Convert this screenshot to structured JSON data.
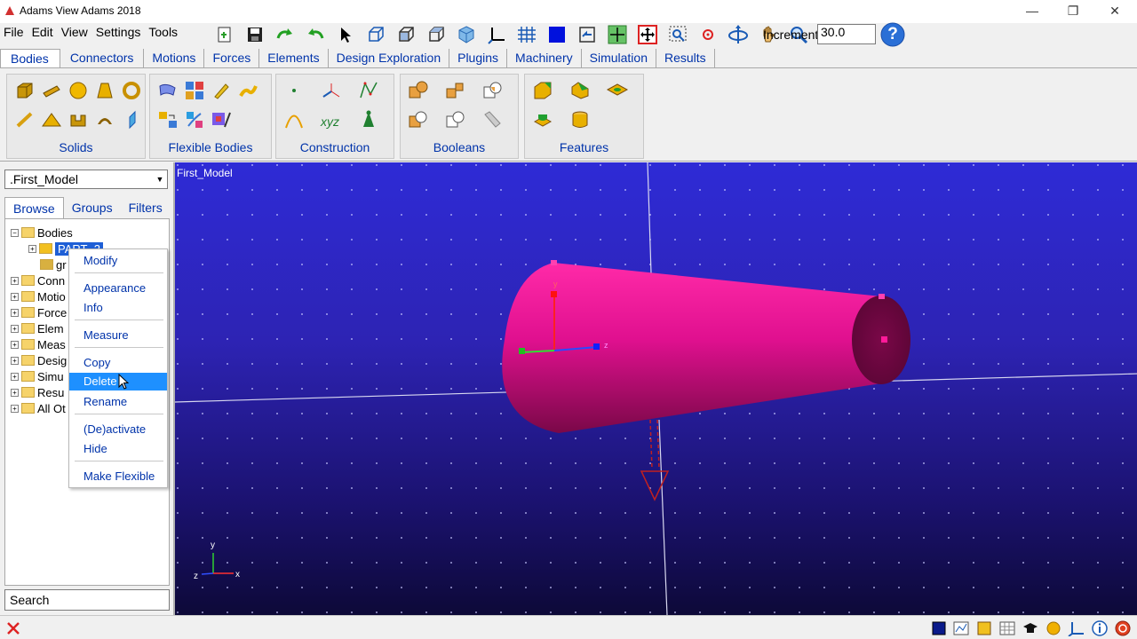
{
  "window": {
    "title": "Adams View Adams 2018",
    "minimize": "—",
    "maximize": "❐",
    "close": "✕"
  },
  "menu": [
    "File",
    "Edit",
    "View",
    "Settings",
    "Tools"
  ],
  "toolbar": {
    "increment_label": "Increment",
    "increment_value": "30.0",
    "help_glyph": "?"
  },
  "ribbon_tabs": [
    "Bodies",
    "Connectors",
    "Motions",
    "Forces",
    "Elements",
    "Design Exploration",
    "Plugins",
    "Machinery",
    "Simulation",
    "Results"
  ],
  "ribbon_groups": {
    "solids": "Solids",
    "flexible": "Flexible Bodies",
    "construction": "Construction",
    "booleans": "Booleans",
    "features": "Features"
  },
  "construction_xyz": "xyz",
  "browser": {
    "model": ".First_Model",
    "tabs": [
      "Browse",
      "Groups",
      "Filters"
    ],
    "tree": {
      "bodies": "Bodies",
      "part": "PART_2",
      "ground": "gr",
      "items": [
        "Conn",
        "Motio",
        "Force",
        "Elem",
        "Meas",
        "Desig",
        "Simu",
        "Resu",
        "All Ot"
      ]
    },
    "search": "Search"
  },
  "viewport": {
    "label": "First_Model",
    "triad": {
      "x": "x",
      "y": "y",
      "z": "z"
    },
    "marker_z": "z",
    "marker_y": "y"
  },
  "context_menu": {
    "modify": "Modify",
    "appearance": "Appearance",
    "info": "Info",
    "measure": "Measure",
    "copy": "Copy",
    "delete": "Delete",
    "rename": "Rename",
    "deactivate": "(De)activate",
    "hide": "Hide",
    "make_flexible": "Make Flexible"
  },
  "colors": {
    "accent": "#0033aa",
    "highlight": "#1e90ff",
    "part": "#e0108f",
    "viewport_top": "#2e2bd6"
  }
}
